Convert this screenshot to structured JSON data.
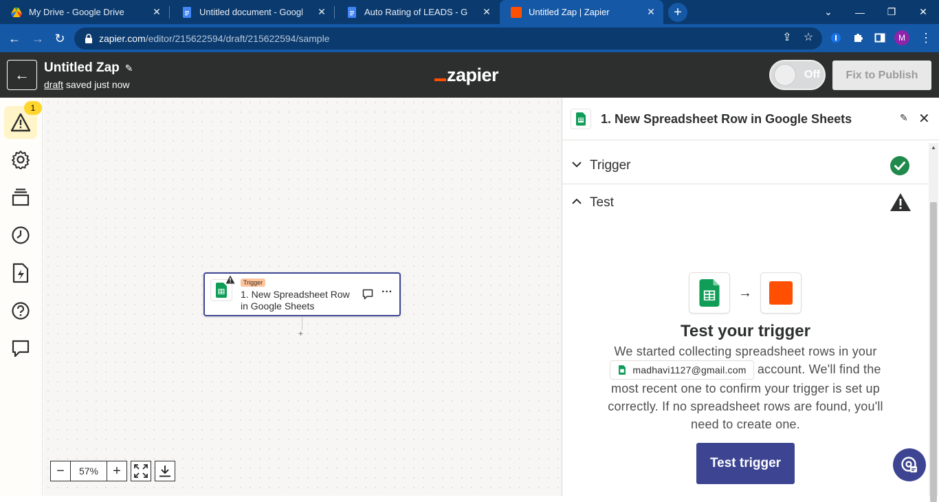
{
  "browser": {
    "tabs": [
      {
        "title": "My Drive - Google Drive",
        "icon": "google-drive-icon"
      },
      {
        "title": "Untitled document - Google Docs",
        "icon": "google-docs-icon"
      },
      {
        "title": "Auto Rating of LEADS - Google Docs",
        "icon": "google-docs-icon"
      },
      {
        "title": "Untitled Zap | Zapier",
        "icon": "zapier-icon"
      }
    ],
    "url_host": "zapier.com",
    "url_path": "/editor/215622594/draft/215622594/sample",
    "profile_initial": "M"
  },
  "header": {
    "zap_title": "Untitled Zap",
    "status_link": "draft",
    "status_text": "saved just now",
    "logo": "zapier",
    "toggle_label": "Off",
    "publish_label": "Fix to Publish"
  },
  "sidebar": {
    "warning_count": "1"
  },
  "canvas": {
    "node_badge": "Trigger",
    "node_title": "1. New Spreadsheet Row in Google Sheets",
    "add_step": "+",
    "zoom_level": "57%"
  },
  "panel": {
    "title": "1. New Spreadsheet Row in Google Sheets",
    "sections": [
      {
        "label": "Trigger",
        "status": "complete"
      },
      {
        "label": "Test",
        "status": "warning"
      }
    ],
    "test_title": "Test your trigger",
    "body_before": "We started collecting spreadsheet rows in your",
    "account_email": "madhavi1127@gmail.com",
    "body_after": "account. We'll find the most recent one to confirm your trigger is set up correctly. If no spreadsheet rows are found, you'll need to create one.",
    "test_button": "Test trigger"
  },
  "colors": {
    "zapier_orange": "#ff4f00",
    "primary_blue": "#3d4592",
    "success_green": "#1f8a4c",
    "sheets_green": "#0f9d58"
  }
}
